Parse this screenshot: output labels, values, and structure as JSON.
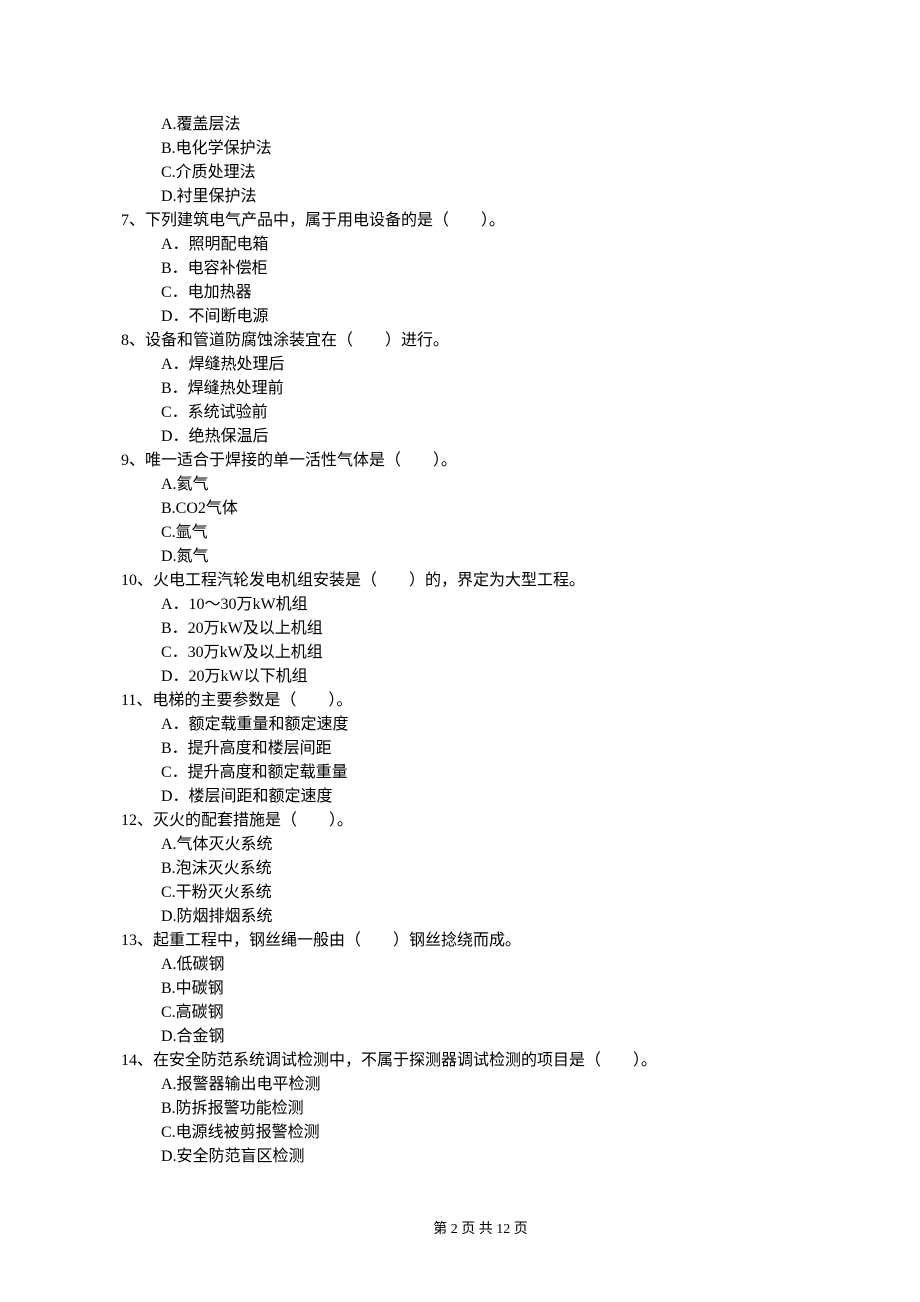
{
  "orphan_options": [
    "A.覆盖层法",
    "B.电化学保护法",
    "C.介质处理法",
    "D.衬里保护法"
  ],
  "questions": [
    {
      "num": "7、",
      "stem": "下列建筑电气产品中，属于用电设备的是（　　）。",
      "opts": [
        "A．照明配电箱",
        "B．电容补偿柜",
        "C．电加热器",
        "D．不间断电源"
      ]
    },
    {
      "num": "8、",
      "stem": "设备和管道防腐蚀涂装宜在（　　）进行。",
      "opts": [
        "A．焊缝热处理后",
        "B．焊缝热处理前",
        "C．系统试验前",
        "D．绝热保温后"
      ]
    },
    {
      "num": "9、",
      "stem": "唯一适合于焊接的单一活性气体是（　　）。",
      "opts": [
        "A.氦气",
        "B.CO2气体",
        "C.氩气",
        "D.氮气"
      ]
    },
    {
      "num": "10、",
      "stem": "火电工程汽轮发电机组安装是（　　）的，界定为大型工程。",
      "opts": [
        "A．10～30万kW机组",
        "B．20万kW及以上机组",
        "C．30万kW及以上机组",
        "D．20万kW以下机组"
      ]
    },
    {
      "num": "11、",
      "stem": "电梯的主要参数是（　　）。",
      "opts": [
        "A．额定载重量和额定速度",
        "B．提升高度和楼层间距",
        "C．提升高度和额定载重量",
        "D．楼层间距和额定速度"
      ]
    },
    {
      "num": "12、",
      "stem": "灭火的配套措施是（　　）。",
      "opts": [
        "A.气体灭火系统",
        "B.泡沫灭火系统",
        "C.干粉灭火系统",
        "D.防烟排烟系统"
      ]
    },
    {
      "num": "13、",
      "stem": "起重工程中，钢丝绳一般由（　　）钢丝捻绕而成。",
      "opts": [
        "A.低碳钢",
        "B.中碳钢",
        "C.高碳钢",
        "D.合金钢"
      ]
    },
    {
      "num": "14、",
      "stem": "在安全防范系统调试检测中，不属于探测器调试检测的项目是（　　）。",
      "opts": [
        "A.报警器输出电平检测",
        "B.防拆报警功能检测",
        "C.电源线被剪报警检测",
        "D.安全防范盲区检测"
      ]
    }
  ],
  "footer": "第 2 页 共 12 页"
}
